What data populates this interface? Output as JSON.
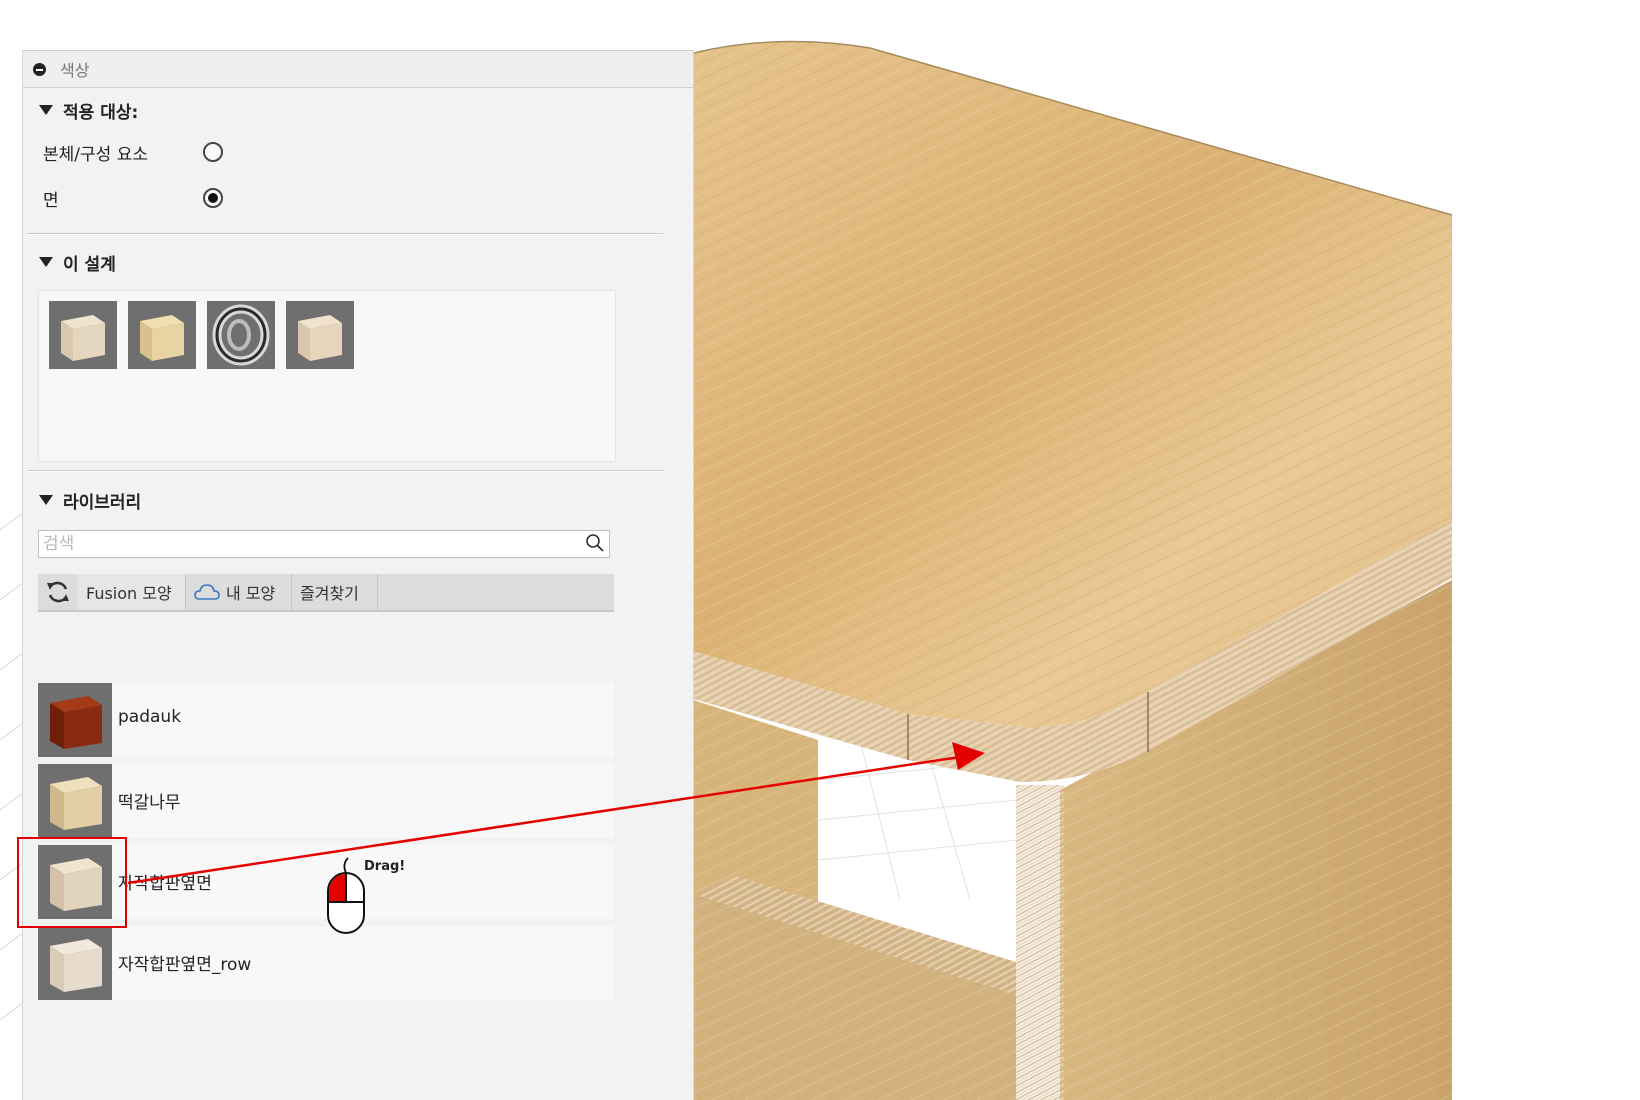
{
  "panel": {
    "title": "색상",
    "apply_to": {
      "heading": "적용 대상:",
      "options": [
        {
          "label": "본체/구성 요소",
          "selected": false
        },
        {
          "label": "면",
          "selected": true
        }
      ]
    },
    "this_design": {
      "heading": "이 설계",
      "swatches": [
        "wood-cube-icon",
        "pine-cube-icon",
        "metal-ring-icon",
        "wood-cube-icon"
      ]
    },
    "library": {
      "heading": "라이브러리",
      "search_placeholder": "검색",
      "tabs": [
        {
          "label": "Fusion 모양"
        },
        {
          "label": "내 모양"
        },
        {
          "label": "즐겨찾기"
        }
      ],
      "items": [
        {
          "label": "padauk",
          "color": "#8a2a12"
        },
        {
          "label": "떡갈나무",
          "color": "#d9c29a"
        },
        {
          "label": "자작합판옆면",
          "color": "#dccab0"
        },
        {
          "label": "자작합판옆면_row",
          "color": "#e3d7c6"
        }
      ]
    }
  },
  "annotation": {
    "drag_label": "Drag!",
    "arrow_color": "#e50000"
  }
}
